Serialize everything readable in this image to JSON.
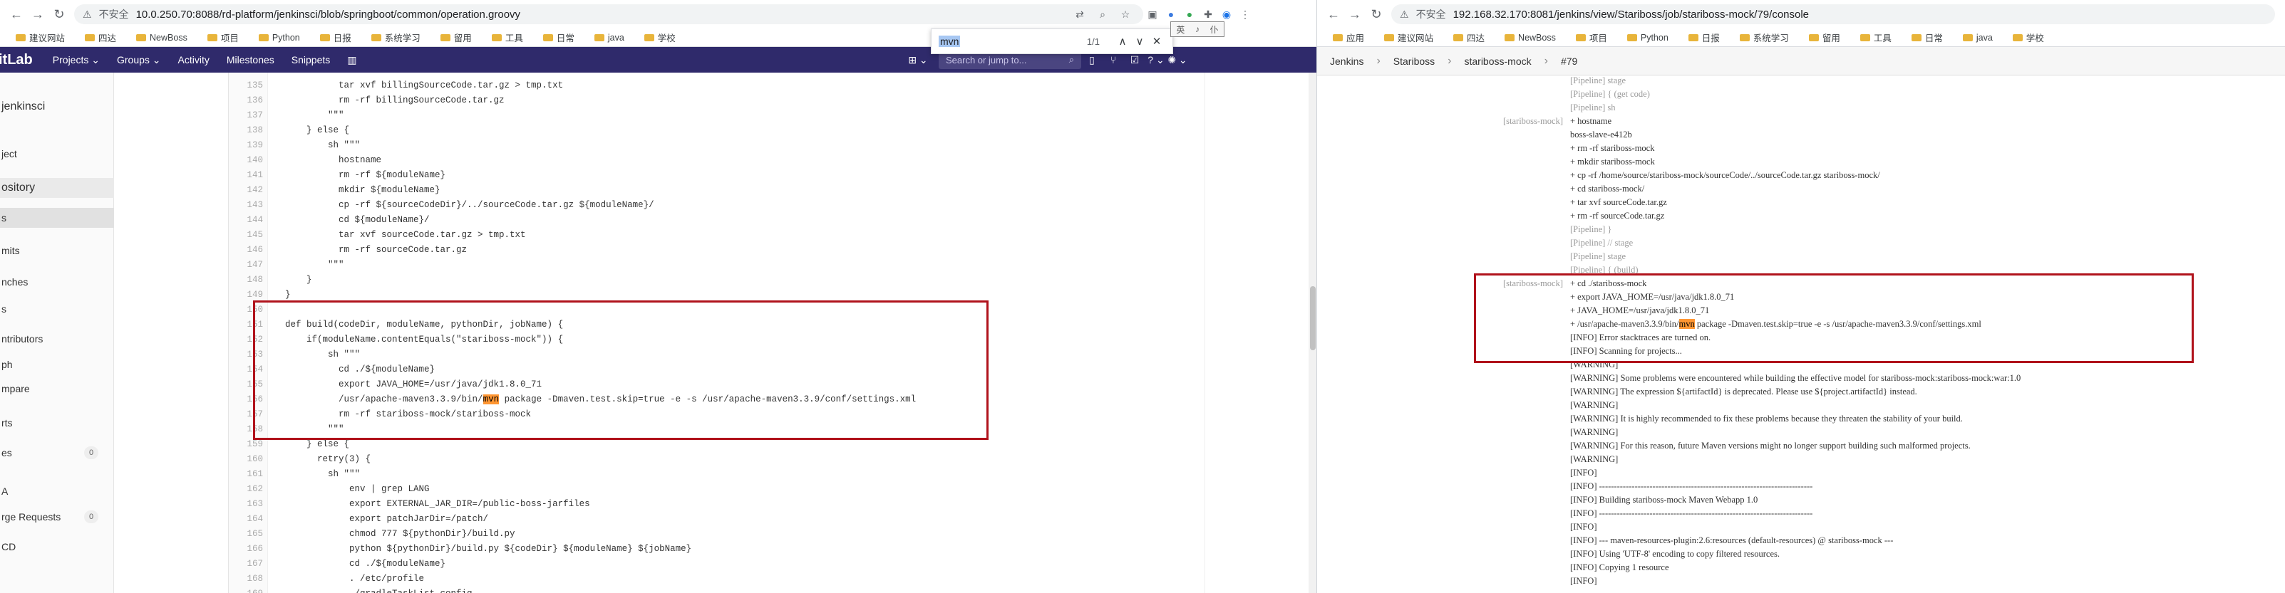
{
  "left": {
    "insecure_label": "不安全",
    "url": "10.0.250.70:8088/rd-platform/jenkinsci/blob/springboot/common/operation.groovy",
    "bookmarks": [
      "建议网站",
      "四达",
      "NewBoss",
      "项目",
      "Python",
      "日报",
      "系统学习",
      "留用",
      "工具",
      "日常",
      "java",
      "学校"
    ],
    "find": {
      "query": "mvn",
      "count": "1/1"
    },
    "ime": [
      "英",
      "♪",
      "仆"
    ],
    "gitlab": {
      "logo": "itLab",
      "nav": [
        "Projects ⌄",
        "Groups ⌄",
        "Activity",
        "Milestones",
        "Snippets"
      ],
      "search_placeholder": "Search or jump to...",
      "project_name": "jenkinsci",
      "sidebar": [
        {
          "label": "ject",
          "badge": ""
        },
        {
          "label": "ository",
          "badge": ""
        },
        {
          "label": "s",
          "badge": ""
        },
        {
          "label": "mits",
          "badge": ""
        },
        {
          "label": "nches",
          "badge": ""
        },
        {
          "label": "s",
          "badge": ""
        },
        {
          "label": "ntributors",
          "badge": ""
        },
        {
          "label": "ph",
          "badge": ""
        },
        {
          "label": "mpare",
          "badge": ""
        },
        {
          "label": "rts",
          "badge": ""
        },
        {
          "label": "es",
          "badge": "0"
        },
        {
          "label": "A",
          "badge": ""
        },
        {
          "label": "rge Requests",
          "badge": "0"
        },
        {
          "label": "CD",
          "badge": ""
        }
      ]
    },
    "code": [
      {
        "ln": "135",
        "t": "            tar xvf billingSourceCode.tar.gz > tmp.txt"
      },
      {
        "ln": "136",
        "t": "            rm -rf billingSourceCode.tar.gz"
      },
      {
        "ln": "137",
        "t": "          \"\"\""
      },
      {
        "ln": "138",
        "t": "      } else {"
      },
      {
        "ln": "139",
        "t": "          sh \"\"\""
      },
      {
        "ln": "140",
        "t": "            hostname"
      },
      {
        "ln": "141",
        "t": "            rm -rf ${moduleName}"
      },
      {
        "ln": "142",
        "t": "            mkdir ${moduleName}"
      },
      {
        "ln": "143",
        "t": "            cp -rf ${sourceCodeDir}/../sourceCode.tar.gz ${moduleName}/"
      },
      {
        "ln": "144",
        "t": "            cd ${moduleName}/"
      },
      {
        "ln": "145",
        "t": "            tar xvf sourceCode.tar.gz > tmp.txt"
      },
      {
        "ln": "146",
        "t": "            rm -rf sourceCode.tar.gz"
      },
      {
        "ln": "147",
        "t": "          \"\"\""
      },
      {
        "ln": "148",
        "t": "      }"
      },
      {
        "ln": "149",
        "t": "  }"
      },
      {
        "ln": "150",
        "t": ""
      },
      {
        "ln": "151",
        "t": "  def build(codeDir, moduleName, pythonDir, jobName) {"
      },
      {
        "ln": "152",
        "t": "      if(moduleName.contentEquals(\"stariboss-mock\")) {"
      },
      {
        "ln": "153",
        "t": "          sh \"\"\""
      },
      {
        "ln": "154",
        "t": "            cd ./${moduleName}"
      },
      {
        "ln": "155",
        "t": "            export JAVA_HOME=/usr/java/jdk1.8.0_71"
      },
      {
        "ln": "156",
        "t": "            /usr/apache-maven3.3.9/bin/mvn package -Dmaven.test.skip=true -e -s /usr/apache-maven3.3.9/conf/settings.xml"
      },
      {
        "ln": "157",
        "t": "            rm -rf stariboss-mock/stariboss-mock"
      },
      {
        "ln": "158",
        "t": "          \"\"\""
      },
      {
        "ln": "159",
        "t": "      } else {"
      },
      {
        "ln": "160",
        "t": "        retry(3) {"
      },
      {
        "ln": "161",
        "t": "          sh \"\"\""
      },
      {
        "ln": "162",
        "t": "              env | grep LANG"
      },
      {
        "ln": "163",
        "t": "              export EXTERNAL_JAR_DIR=/public-boss-jarfiles"
      },
      {
        "ln": "164",
        "t": "              export patchJarDir=/patch/"
      },
      {
        "ln": "165",
        "t": "              chmod 777 ${pythonDir}/build.py"
      },
      {
        "ln": "166",
        "t": "              python ${pythonDir}/build.py ${codeDir} ${moduleName} ${jobName}"
      },
      {
        "ln": "167",
        "t": "              cd ./${moduleName}"
      },
      {
        "ln": "168",
        "t": "              . /etc/profile"
      },
      {
        "ln": "169",
        "t": "              ./gradleTaskList.config"
      }
    ]
  },
  "right": {
    "insecure_label": "不安全",
    "url": "192.168.32.170:8081/jenkins/view/Stariboss/job/stariboss-mock/79/console",
    "bookmarks": [
      "应用",
      "建议网站",
      "四达",
      "NewBoss",
      "项目",
      "Python",
      "日报",
      "系统学习",
      "留用",
      "工具",
      "日常",
      "java",
      "学校"
    ],
    "breadcrumb": [
      "Jenkins",
      "Stariboss",
      "stariboss-mock",
      "#79"
    ],
    "console": [
      {
        "p": "",
        "t": "[Pipeline] stage",
        "g": true
      },
      {
        "p": "",
        "t": "[Pipeline] { (get code)",
        "g": true
      },
      {
        "p": "",
        "t": "[Pipeline] sh",
        "g": true
      },
      {
        "p": "[stariboss-mock]",
        "t": "+ hostname",
        "g": false
      },
      {
        "p": "",
        "t": "boss-slave-e412b",
        "g": false
      },
      {
        "p": "",
        "t": "+ rm -rf stariboss-mock",
        "g": false
      },
      {
        "p": "",
        "t": "+ mkdir stariboss-mock",
        "g": false
      },
      {
        "p": "",
        "t": "+ cp -rf /home/source/stariboss-mock/sourceCode/../sourceCode.tar.gz stariboss-mock/",
        "g": false
      },
      {
        "p": "",
        "t": "+ cd stariboss-mock/",
        "g": false
      },
      {
        "p": "",
        "t": "+ tar xvf sourceCode.tar.gz",
        "g": false
      },
      {
        "p": "",
        "t": "+ rm -rf sourceCode.tar.gz",
        "g": false
      },
      {
        "p": "",
        "t": "[Pipeline] }",
        "g": true
      },
      {
        "p": "",
        "t": "[Pipeline] // stage",
        "g": true
      },
      {
        "p": "",
        "t": "[Pipeline] stage",
        "g": true
      },
      {
        "p": "",
        "t": "[Pipeline] { (build)",
        "g": true
      },
      {
        "p": "[stariboss-mock]",
        "t": "+ cd ./stariboss-mock",
        "g": false
      },
      {
        "p": "",
        "t": "+ export JAVA_HOME=/usr/java/jdk1.8.0_71",
        "g": false
      },
      {
        "p": "",
        "t": "+ JAVA_HOME=/usr/java/jdk1.8.0_71",
        "g": false
      },
      {
        "p": "",
        "t": "+ /usr/apache-maven3.3.9/bin/mvn package -Dmaven.test.skip=true -e -s /usr/apache-maven3.3.9/conf/settings.xml",
        "g": false
      },
      {
        "p": "",
        "t": "[INFO] Error stacktraces are turned on.",
        "g": false
      },
      {
        "p": "",
        "t": "[INFO] Scanning for projects...",
        "g": false
      },
      {
        "p": "",
        "t": "[WARNING]",
        "g": false
      },
      {
        "p": "",
        "t": "[WARNING] Some problems were encountered while building the effective model for stariboss-mock:stariboss-mock:war:1.0",
        "g": false
      },
      {
        "p": "",
        "t": "[WARNING] The expression ${artifactId} is deprecated. Please use ${project.artifactId} instead.",
        "g": false
      },
      {
        "p": "",
        "t": "[WARNING]",
        "g": false
      },
      {
        "p": "",
        "t": "[WARNING] It is highly recommended to fix these problems because they threaten the stability of your build.",
        "g": false
      },
      {
        "p": "",
        "t": "[WARNING]",
        "g": false
      },
      {
        "p": "",
        "t": "[WARNING] For this reason, future Maven versions might no longer support building such malformed projects.",
        "g": false
      },
      {
        "p": "",
        "t": "[WARNING]",
        "g": false
      },
      {
        "p": "",
        "t": "[INFO]",
        "g": false
      },
      {
        "p": "",
        "t": "[INFO] ------------------------------------------------------------------------",
        "g": false
      },
      {
        "p": "",
        "t": "[INFO] Building stariboss-mock Maven Webapp 1.0",
        "g": false
      },
      {
        "p": "",
        "t": "[INFO] ------------------------------------------------------------------------",
        "g": false
      },
      {
        "p": "",
        "t": "[INFO]",
        "g": false
      },
      {
        "p": "",
        "t": "[INFO] --- maven-resources-plugin:2.6:resources (default-resources) @ stariboss-mock ---",
        "g": false
      },
      {
        "p": "",
        "t": "[INFO] Using 'UTF-8' encoding to copy filtered resources.",
        "g": false
      },
      {
        "p": "",
        "t": "[INFO] Copying 1 resource",
        "g": false
      },
      {
        "p": "",
        "t": "[INFO]",
        "g": false
      }
    ]
  },
  "colors": {
    "gitlab_nav": "#2f2a6b",
    "highlight": "#ff9632",
    "annotation": "#b0121b"
  }
}
